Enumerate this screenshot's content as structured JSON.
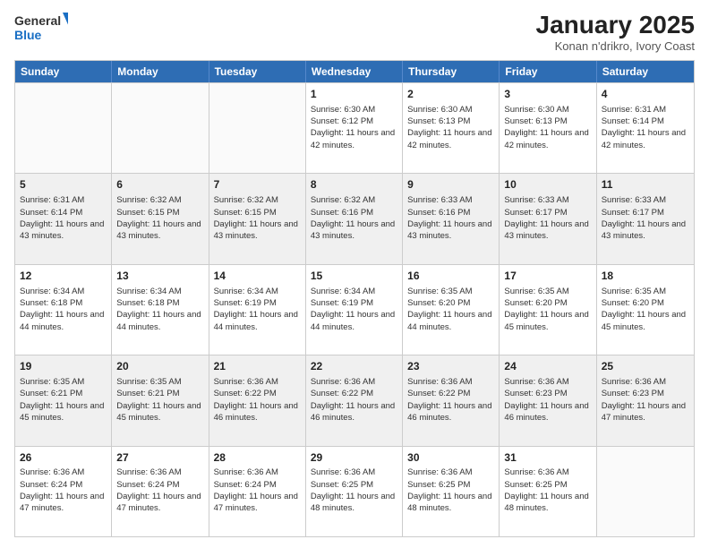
{
  "logo": {
    "general": "General",
    "blue": "Blue"
  },
  "title": {
    "main": "January 2025",
    "sub": "Konan n'drikro, Ivory Coast"
  },
  "days_of_week": [
    "Sunday",
    "Monday",
    "Tuesday",
    "Wednesday",
    "Thursday",
    "Friday",
    "Saturday"
  ],
  "weeks": [
    [
      {
        "day": "",
        "empty": true
      },
      {
        "day": "",
        "empty": true
      },
      {
        "day": "",
        "empty": true
      },
      {
        "day": "1",
        "sunrise": "Sunrise: 6:30 AM",
        "sunset": "Sunset: 6:12 PM",
        "daylight": "Daylight: 11 hours and 42 minutes."
      },
      {
        "day": "2",
        "sunrise": "Sunrise: 6:30 AM",
        "sunset": "Sunset: 6:13 PM",
        "daylight": "Daylight: 11 hours and 42 minutes."
      },
      {
        "day": "3",
        "sunrise": "Sunrise: 6:30 AM",
        "sunset": "Sunset: 6:13 PM",
        "daylight": "Daylight: 11 hours and 42 minutes."
      },
      {
        "day": "4",
        "sunrise": "Sunrise: 6:31 AM",
        "sunset": "Sunset: 6:14 PM",
        "daylight": "Daylight: 11 hours and 42 minutes."
      }
    ],
    [
      {
        "day": "5",
        "sunrise": "Sunrise: 6:31 AM",
        "sunset": "Sunset: 6:14 PM",
        "daylight": "Daylight: 11 hours and 43 minutes."
      },
      {
        "day": "6",
        "sunrise": "Sunrise: 6:32 AM",
        "sunset": "Sunset: 6:15 PM",
        "daylight": "Daylight: 11 hours and 43 minutes."
      },
      {
        "day": "7",
        "sunrise": "Sunrise: 6:32 AM",
        "sunset": "Sunset: 6:15 PM",
        "daylight": "Daylight: 11 hours and 43 minutes."
      },
      {
        "day": "8",
        "sunrise": "Sunrise: 6:32 AM",
        "sunset": "Sunset: 6:16 PM",
        "daylight": "Daylight: 11 hours and 43 minutes."
      },
      {
        "day": "9",
        "sunrise": "Sunrise: 6:33 AM",
        "sunset": "Sunset: 6:16 PM",
        "daylight": "Daylight: 11 hours and 43 minutes."
      },
      {
        "day": "10",
        "sunrise": "Sunrise: 6:33 AM",
        "sunset": "Sunset: 6:17 PM",
        "daylight": "Daylight: 11 hours and 43 minutes."
      },
      {
        "day": "11",
        "sunrise": "Sunrise: 6:33 AM",
        "sunset": "Sunset: 6:17 PM",
        "daylight": "Daylight: 11 hours and 43 minutes."
      }
    ],
    [
      {
        "day": "12",
        "sunrise": "Sunrise: 6:34 AM",
        "sunset": "Sunset: 6:18 PM",
        "daylight": "Daylight: 11 hours and 44 minutes."
      },
      {
        "day": "13",
        "sunrise": "Sunrise: 6:34 AM",
        "sunset": "Sunset: 6:18 PM",
        "daylight": "Daylight: 11 hours and 44 minutes."
      },
      {
        "day": "14",
        "sunrise": "Sunrise: 6:34 AM",
        "sunset": "Sunset: 6:19 PM",
        "daylight": "Daylight: 11 hours and 44 minutes."
      },
      {
        "day": "15",
        "sunrise": "Sunrise: 6:34 AM",
        "sunset": "Sunset: 6:19 PM",
        "daylight": "Daylight: 11 hours and 44 minutes."
      },
      {
        "day": "16",
        "sunrise": "Sunrise: 6:35 AM",
        "sunset": "Sunset: 6:20 PM",
        "daylight": "Daylight: 11 hours and 44 minutes."
      },
      {
        "day": "17",
        "sunrise": "Sunrise: 6:35 AM",
        "sunset": "Sunset: 6:20 PM",
        "daylight": "Daylight: 11 hours and 45 minutes."
      },
      {
        "day": "18",
        "sunrise": "Sunrise: 6:35 AM",
        "sunset": "Sunset: 6:20 PM",
        "daylight": "Daylight: 11 hours and 45 minutes."
      }
    ],
    [
      {
        "day": "19",
        "sunrise": "Sunrise: 6:35 AM",
        "sunset": "Sunset: 6:21 PM",
        "daylight": "Daylight: 11 hours and 45 minutes."
      },
      {
        "day": "20",
        "sunrise": "Sunrise: 6:35 AM",
        "sunset": "Sunset: 6:21 PM",
        "daylight": "Daylight: 11 hours and 45 minutes."
      },
      {
        "day": "21",
        "sunrise": "Sunrise: 6:36 AM",
        "sunset": "Sunset: 6:22 PM",
        "daylight": "Daylight: 11 hours and 46 minutes."
      },
      {
        "day": "22",
        "sunrise": "Sunrise: 6:36 AM",
        "sunset": "Sunset: 6:22 PM",
        "daylight": "Daylight: 11 hours and 46 minutes."
      },
      {
        "day": "23",
        "sunrise": "Sunrise: 6:36 AM",
        "sunset": "Sunset: 6:22 PM",
        "daylight": "Daylight: 11 hours and 46 minutes."
      },
      {
        "day": "24",
        "sunrise": "Sunrise: 6:36 AM",
        "sunset": "Sunset: 6:23 PM",
        "daylight": "Daylight: 11 hours and 46 minutes."
      },
      {
        "day": "25",
        "sunrise": "Sunrise: 6:36 AM",
        "sunset": "Sunset: 6:23 PM",
        "daylight": "Daylight: 11 hours and 47 minutes."
      }
    ],
    [
      {
        "day": "26",
        "sunrise": "Sunrise: 6:36 AM",
        "sunset": "Sunset: 6:24 PM",
        "daylight": "Daylight: 11 hours and 47 minutes."
      },
      {
        "day": "27",
        "sunrise": "Sunrise: 6:36 AM",
        "sunset": "Sunset: 6:24 PM",
        "daylight": "Daylight: 11 hours and 47 minutes."
      },
      {
        "day": "28",
        "sunrise": "Sunrise: 6:36 AM",
        "sunset": "Sunset: 6:24 PM",
        "daylight": "Daylight: 11 hours and 47 minutes."
      },
      {
        "day": "29",
        "sunrise": "Sunrise: 6:36 AM",
        "sunset": "Sunset: 6:25 PM",
        "daylight": "Daylight: 11 hours and 48 minutes."
      },
      {
        "day": "30",
        "sunrise": "Sunrise: 6:36 AM",
        "sunset": "Sunset: 6:25 PM",
        "daylight": "Daylight: 11 hours and 48 minutes."
      },
      {
        "day": "31",
        "sunrise": "Sunrise: 6:36 AM",
        "sunset": "Sunset: 6:25 PM",
        "daylight": "Daylight: 11 hours and 48 minutes."
      },
      {
        "day": "",
        "empty": true
      }
    ]
  ]
}
